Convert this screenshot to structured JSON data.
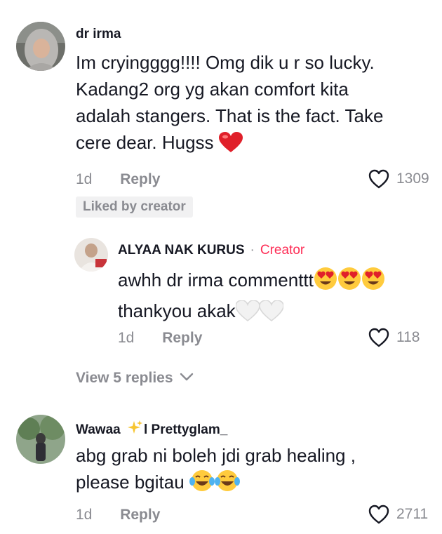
{
  "comments": [
    {
      "username": "dr irma",
      "text_lines": [
        "Im cryingggg!!!! Omg dik u r so lucky.",
        "Kadang2 org yg akan comfort kita",
        "adalah stangers. That is the fact. Take",
        "cere dear. Hugss"
      ],
      "date": "1d",
      "reply_label": "Reply",
      "like_count": "1309",
      "badge": "Liked by creator",
      "avatar_icon": "hijab-avatar",
      "reply": {
        "username": "ALYAA NAK KURUS",
        "separator": "·",
        "role": "Creator",
        "text_lines": [
          "awhh dr irma commenttt",
          "thankyou akak"
        ],
        "date": "1d",
        "reply_label": "Reply",
        "like_count": "118",
        "avatar_icon": "creator-avatar"
      },
      "view_replies": "View 5 replies"
    },
    {
      "username": "Wawaa",
      "username_suffix": "l Prettyglam_",
      "text_lines": [
        "abg grab ni boleh jdi grab healing ,",
        "please bgitau"
      ],
      "date": "1d",
      "reply_label": "Reply",
      "like_count": "2711",
      "avatar_icon": "garden-avatar"
    }
  ],
  "colors": {
    "text": "#161823",
    "muted": "#8a8b91",
    "creator": "#fe2c55",
    "badge_bg": "#f1f1f2"
  }
}
